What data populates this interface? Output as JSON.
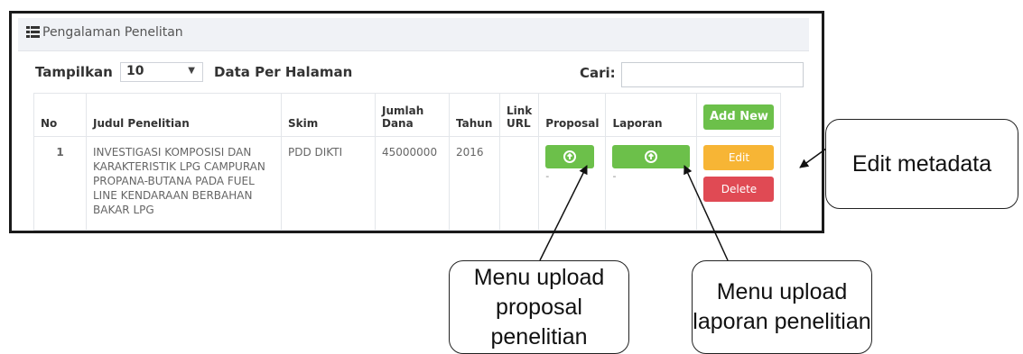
{
  "panel": {
    "title": "Pengalaman Penelitan"
  },
  "controls": {
    "show_label": "Tampilkan",
    "page_size": "10",
    "per_page_label": "Data Per Halaman",
    "search_label": "Cari:",
    "search_value": ""
  },
  "table": {
    "headers": {
      "no": "No",
      "judul": "Judul Penelitian",
      "skim": "Skim",
      "jumlah_dana": "Jumlah Dana",
      "tahun": "Tahun",
      "link_url": "Link URL",
      "proposal": "Proposal",
      "laporan": "Laporan",
      "add_new": "Add New"
    },
    "rows": [
      {
        "no": "1",
        "judul": "INVESTIGASI KOMPOSISI DAN KARAKTERISTIK LPG CAMPURAN PROPANA-BUTANA PADA FUEL LINE KENDARAAN BERBAHAN BAKAR LPG",
        "skim": "PDD DIKTI",
        "jumlah_dana": "45000000",
        "tahun": "2016",
        "link_url": "",
        "proposal_file": "-",
        "laporan_file": "-",
        "edit_label": "Edit",
        "delete_label": "Delete"
      }
    ]
  },
  "callouts": {
    "edit": "Edit metadata",
    "proposal": "Menu upload proposal penelitian",
    "laporan": "Menu upload laporan penelitian"
  },
  "colors": {
    "green": "#6cc04a",
    "orange": "#f7b535",
    "red": "#e04a54",
    "header_bg": "#f0f2f6"
  },
  "icons": {
    "panel_icon": "list-icon",
    "upload_icon": "upload-circle-icon"
  }
}
